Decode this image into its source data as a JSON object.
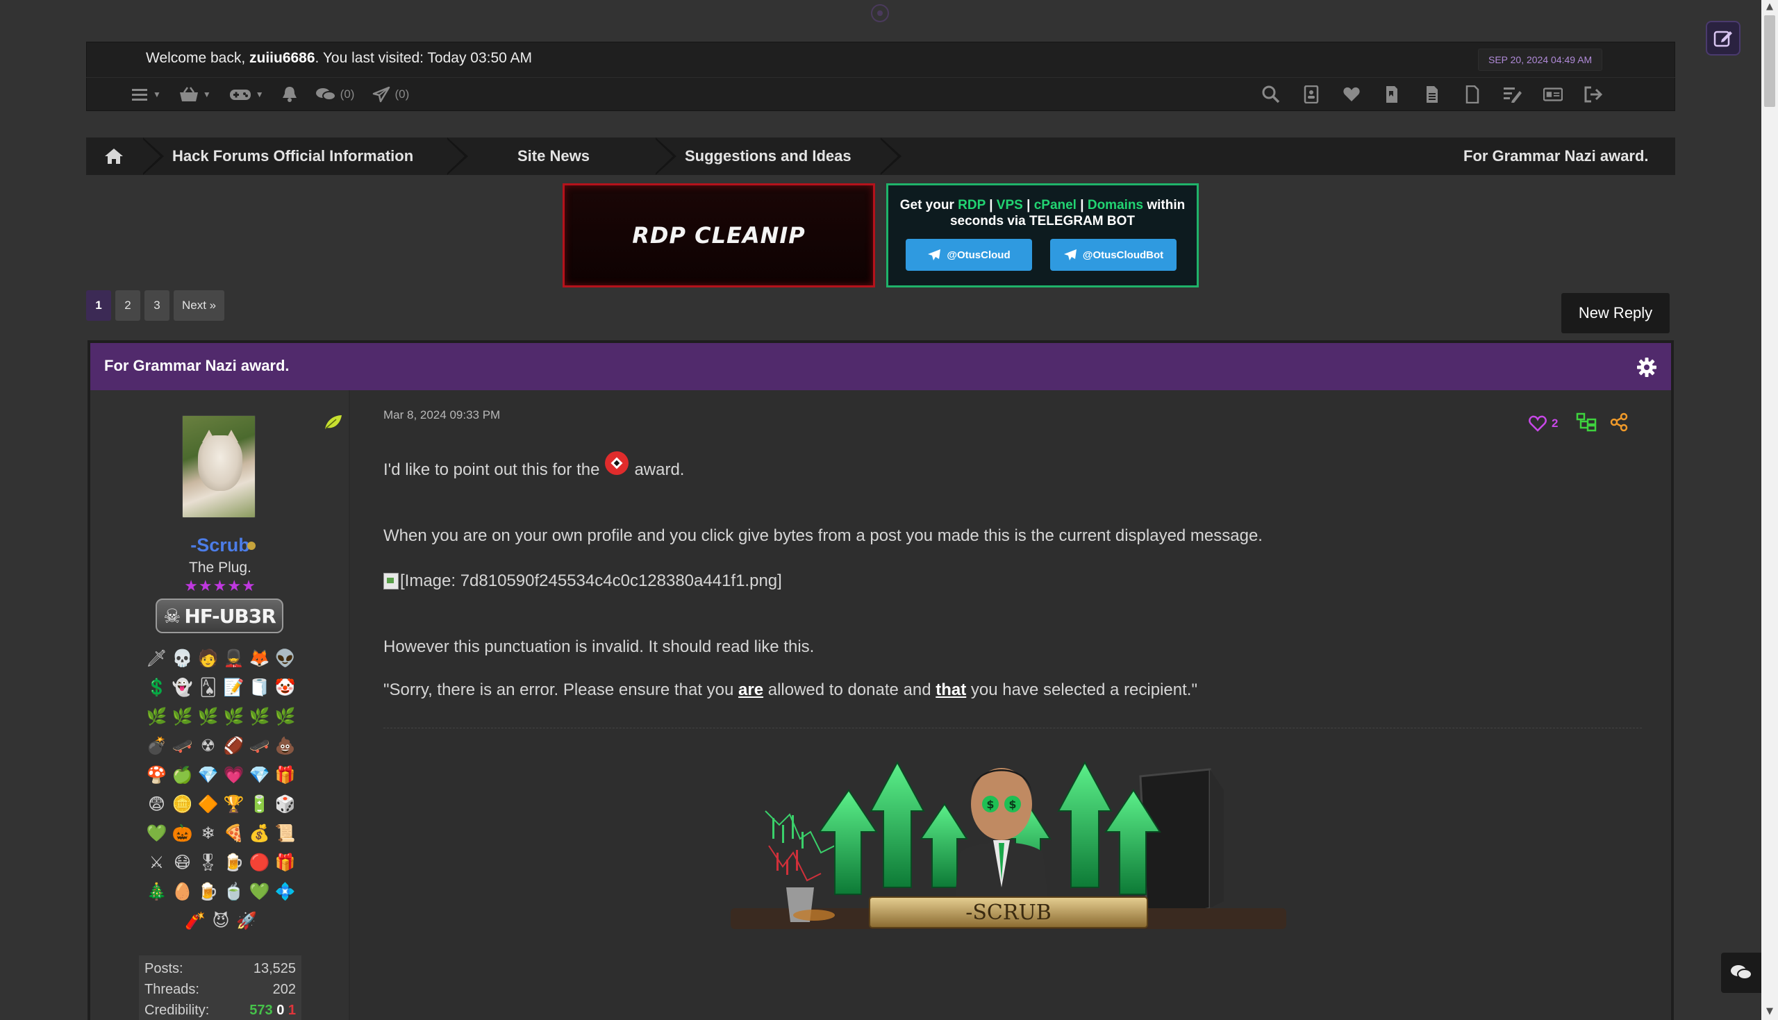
{
  "header": {
    "welcome_prefix": "Welcome back, ",
    "username": "zuiiu6686",
    "welcome_suffix": ". You last visited: Today 03:50 AM",
    "datetime": "SEP 20, 2024 04:49 AM",
    "toolbar_left": [
      {
        "icon": "menu-icon",
        "count": ""
      },
      {
        "icon": "basket-icon",
        "count": ""
      },
      {
        "icon": "gamepad-icon",
        "count": ""
      },
      {
        "icon": "bell-icon",
        "count": ""
      },
      {
        "icon": "chat-icon",
        "count": "(0)"
      },
      {
        "icon": "send-icon",
        "count": "(0)"
      }
    ],
    "toolbar_right_icons": [
      "search-icon",
      "contacts-icon",
      "heart-icon",
      "bookmark-icon",
      "document-icon",
      "file-icon",
      "edit-list-icon",
      "card-icon",
      "logout-icon"
    ]
  },
  "breadcrumb": {
    "items": [
      "Hack Forums Official Information",
      "Site News",
      "Suggestions and Ideas"
    ],
    "current": "For Grammar Nazi award."
  },
  "banners": {
    "rdp": "RDP CLEANIP",
    "otus_line1_a": "Get your ",
    "otus_rdp": "RDP",
    "otus_vps": "VPS",
    "otus_cpanel": "cPanel",
    "otus_domains": "Domains",
    "otus_line1_b": " within",
    "otus_line2": "seconds via TELEGRAM BOT",
    "otus_btn1": "@OtusCloud",
    "otus_btn2": "@OtusCloudBot"
  },
  "pagination": {
    "pages": [
      "1",
      "2",
      "3"
    ],
    "current": "1",
    "next": "Next »"
  },
  "new_reply": "New Reply",
  "thread": {
    "title": "For Grammar Nazi award."
  },
  "author": {
    "name": "-Scrub",
    "title": "The Plug.",
    "stars": "★★★★★",
    "group_badge": "HF-UB3R",
    "stats": {
      "posts_label": "Posts:",
      "posts": "13,525",
      "threads_label": "Threads:",
      "threads": "202",
      "cred_label": "Credibility:",
      "cred_pos": "573",
      "cred_neu": "0",
      "cred_neg": "1"
    }
  },
  "post": {
    "date": "Mar 8, 2024 09:33 PM",
    "likes": "2",
    "p1_a": "I'd like to point out this for the",
    "p1_b": "award.",
    "p2": "When you are on your own profile and you click give bytes from a post you made this is the current displayed message.",
    "p3": "[Image: 7d810590f245534c4c0c128380a441f1.png]",
    "p4": "However this punctuation is invalid. It should read like this.",
    "p5_a": "\"Sorry, there is an error. Please ensure that you ",
    "p5_are": "are",
    "p5_b": " allowed to donate and ",
    "p5_that": "that",
    "p5_c": " you have selected a recipient.\"",
    "signature_name": "-SCRUB"
  },
  "colors": {
    "accent_purple": "#512a6c",
    "username_blue": "#4c7de8",
    "otus_green": "#1fb36a",
    "rdp_red": "#b5121b"
  }
}
